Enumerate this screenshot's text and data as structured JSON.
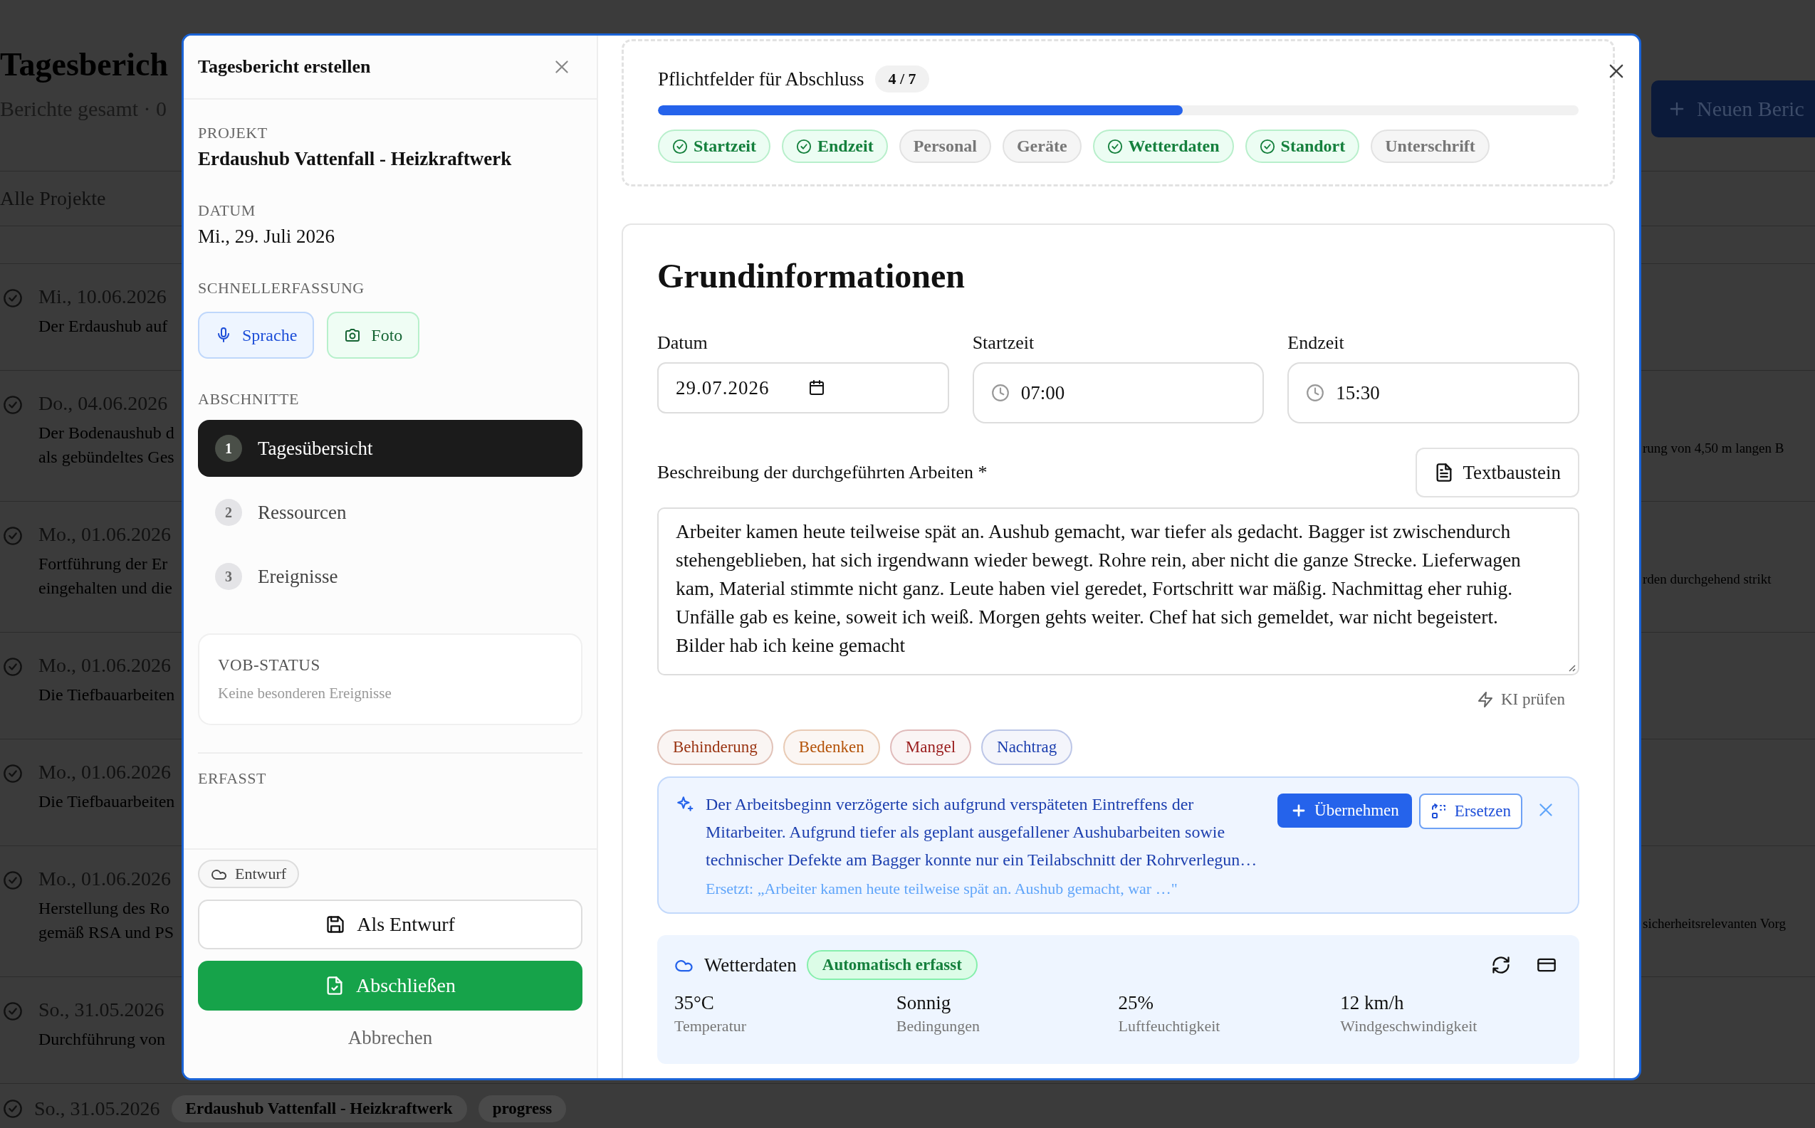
{
  "background": {
    "title": "Tagesberich",
    "subtitle": "Berichte gesamt · 0",
    "filter": "Alle Projekte",
    "new_button": "Neuen Beric",
    "reports": [
      {
        "date": "Mi., 10.06.2026",
        "snippet": [
          "Der Erdaushub auf"
        ]
      },
      {
        "date": "Do., 04.06.2026",
        "snippet": [
          "Der Bodenaushub d",
          "als gebündeltes Ges"
        ],
        "snippet_right": "rung von 4,50 m langen B"
      },
      {
        "date": "Mo., 01.06.2026",
        "snippet": [
          "Fortführung der Er",
          "eingehalten und die"
        ],
        "snippet_right": "rden durchgehend strikt"
      },
      {
        "date": "Mo., 01.06.2026",
        "snippet": [
          "Die Tiefbauarbeiten"
        ]
      },
      {
        "date": "Mo., 01.06.2026",
        "snippet": [
          "Die Tiefbauarbeiten"
        ]
      },
      {
        "date": "Mo., 01.06.2026",
        "snippet": [
          "Herstellung des Ro",
          "gemäß RSA und PS"
        ],
        "snippet_right": "sicherheitsrelevanten Vorg"
      },
      {
        "date": "So., 31.05.2026",
        "snippet": [
          "Durchführung von"
        ]
      },
      {
        "date": "So., 31.05.2026",
        "badges": [
          "Erdaushub Vattenfall - Heizkraftwerk",
          "progress"
        ]
      }
    ]
  },
  "dialog": {
    "sidebar": {
      "title": "Tagesbericht erstellen",
      "project_label": "PROJEKT",
      "project": "Erdaushub Vattenfall - Heizkraftwerk",
      "date_label": "DATUM",
      "date": "Mi., 29. Juli 2026",
      "quick_label": "SCHNELLERFASSUNG",
      "quick_buttons": [
        {
          "kind": "voice",
          "label": "Sprache"
        },
        {
          "kind": "photo",
          "label": "Foto"
        }
      ],
      "sections_label": "ABSCHNITTE",
      "sections": [
        {
          "number": "1",
          "label": "Tagesübersicht",
          "selected": true
        },
        {
          "number": "2",
          "label": "Ressourcen",
          "selected": false
        },
        {
          "number": "3",
          "label": "Ereignisse",
          "selected": false
        }
      ],
      "vob": {
        "title": "VOB-STATUS",
        "text": "Keine besonderen Ereignisse"
      },
      "captured_label": "ERFASST",
      "status": "Entwurf",
      "save_button": "Als Entwurf",
      "finish_button": "Abschließen",
      "cancel": "Abbrechen"
    },
    "progress": {
      "title": "Pflichtfelder für Abschluss",
      "count": "4 / 7",
      "level": 0.57,
      "fields": [
        {
          "label": "Startzeit",
          "done": true
        },
        {
          "label": "Endzeit",
          "done": true
        },
        {
          "label": "Personal",
          "done": false
        },
        {
          "label": "Geräte",
          "done": false
        },
        {
          "label": "Wetterdaten",
          "done": true
        },
        {
          "label": "Standort",
          "done": true
        },
        {
          "label": "Unterschrift",
          "done": false
        }
      ]
    },
    "basic": {
      "title": "Grundinformationen",
      "fields": [
        {
          "kind": "date",
          "label": "Datum",
          "value": "29.07.2026"
        },
        {
          "kind": "time",
          "label": "Startzeit",
          "value": "07:00"
        },
        {
          "kind": "time",
          "label": "Endzeit",
          "value": "15:30"
        }
      ],
      "description_label": "Beschreibung der durchgeführten Arbeiten *",
      "template_button": "Textbaustein",
      "description": "Arbeiter kamen heute teilweise spät an. Aushub gemacht, war tiefer als gedacht. Bagger ist zwischendurch stehengeblieben, hat sich irgendwann wieder bewegt. Rohre rein, aber nicht die ganze Strecke. Lieferwagen kam, Material stimmte nicht ganz. Leute haben viel geredet, Fortschritt war mäßig. Nachmittag eher ruhig. Unfälle gab es keine, soweit ich weiß. Morgen gehts weiter. Chef hat sich gemeldet, war nicht begeistert. Bilder hab ich keine gemacht",
      "ai_check": "KI prüfen",
      "tags": [
        {
          "label": "Behinderung",
          "color": "#9a3412"
        },
        {
          "label": "Bedenken",
          "color": "#b45309"
        },
        {
          "label": "Mangel",
          "color": "#991b1b"
        },
        {
          "label": "Nachtrag",
          "color": "#1e40af"
        }
      ],
      "suggestion": {
        "text": "Der Arbeitsbeginn verzögerte sich aufgrund verspäteten Eintreffens der Mitarbeiter. Aufgrund tiefer als geplant ausgefallener Aushubarbeiten sowie technischer Defekte am Bagger konnte nur ein Teilabschnitt der Rohrverlegun…",
        "replaces": "Ersetzt: „Arbeiter kamen heute teilweise spät an. Aushub gemacht, war …\"",
        "accept": "Übernehmen",
        "replace": "Ersetzen"
      },
      "weather": {
        "title": "Wetterdaten",
        "badge": "Automatisch erfasst",
        "stats": [
          {
            "value": "35°C",
            "label": "Temperatur"
          },
          {
            "value": "Sonnig",
            "label": "Bedingungen"
          },
          {
            "value": "25%",
            "label": "Luftfeuchtigkeit"
          },
          {
            "value": "12 km/h",
            "label": "Windgeschwindigkeit"
          }
        ]
      }
    }
  }
}
